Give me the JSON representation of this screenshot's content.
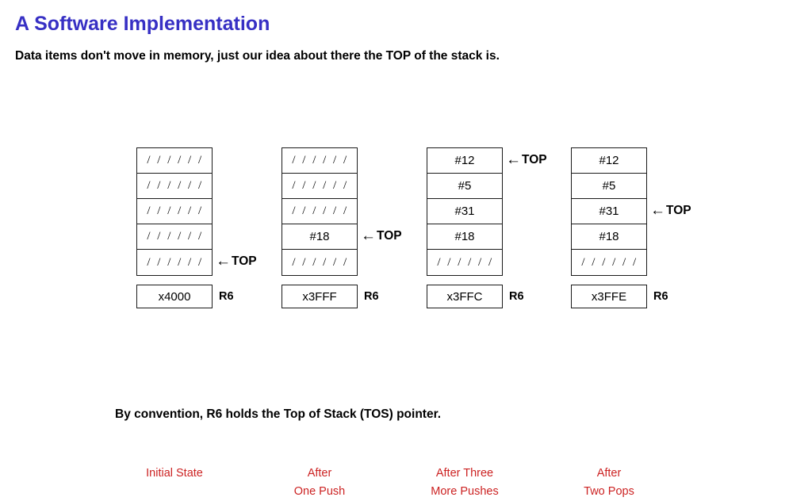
{
  "slide": {
    "title": "A Software Implementation",
    "subtitle": "Data items don't move in memory, just our idea about there the TOP of the stack is.",
    "footer_note": "By convention, R6 holds the Top of Stack (TOS) pointer.",
    "title_color": "#3730c4",
    "caption_color": "#cc2222",
    "empty_cell_text": "/ / / / / /",
    "top_marker_label": "TOP",
    "top_marker_arrow": "←",
    "register_name": "R6"
  },
  "columns": [
    {
      "id": "initial-state",
      "cells": [
        "/ / / / / /",
        "/ / / / / /",
        "/ / / / / /",
        "/ / / / / /",
        "/ / / / / /"
      ],
      "top_index": 4,
      "register_value": "x4000",
      "register_label": "R6",
      "caption_lines": [
        "Initial State"
      ]
    },
    {
      "id": "after-one-push",
      "cells": [
        "/ / / / / /",
        "/ / / / / /",
        "/ / / / / /",
        "#18",
        "/ / / / / /"
      ],
      "top_index": 3,
      "register_value": "x3FFF",
      "register_label": "R6",
      "caption_lines": [
        "After",
        "One Push"
      ]
    },
    {
      "id": "after-three-more-pushes",
      "cells": [
        "#12",
        "#5",
        "#31",
        "#18",
        "/ / / / / /"
      ],
      "top_index": 0,
      "register_value": "x3FFC",
      "register_label": "R6",
      "caption_lines": [
        "After Three",
        "More Pushes"
      ]
    },
    {
      "id": "after-two-pops",
      "cells": [
        "#12",
        "#5",
        "#31",
        "#18",
        "/ / / / / /"
      ],
      "top_index": 2,
      "register_value": "x3FFE",
      "register_label": "R6",
      "caption_lines": [
        "After",
        "Two Pops"
      ]
    }
  ],
  "layout": {
    "column_left_positions": [
      172,
      355,
      538,
      720
    ]
  }
}
